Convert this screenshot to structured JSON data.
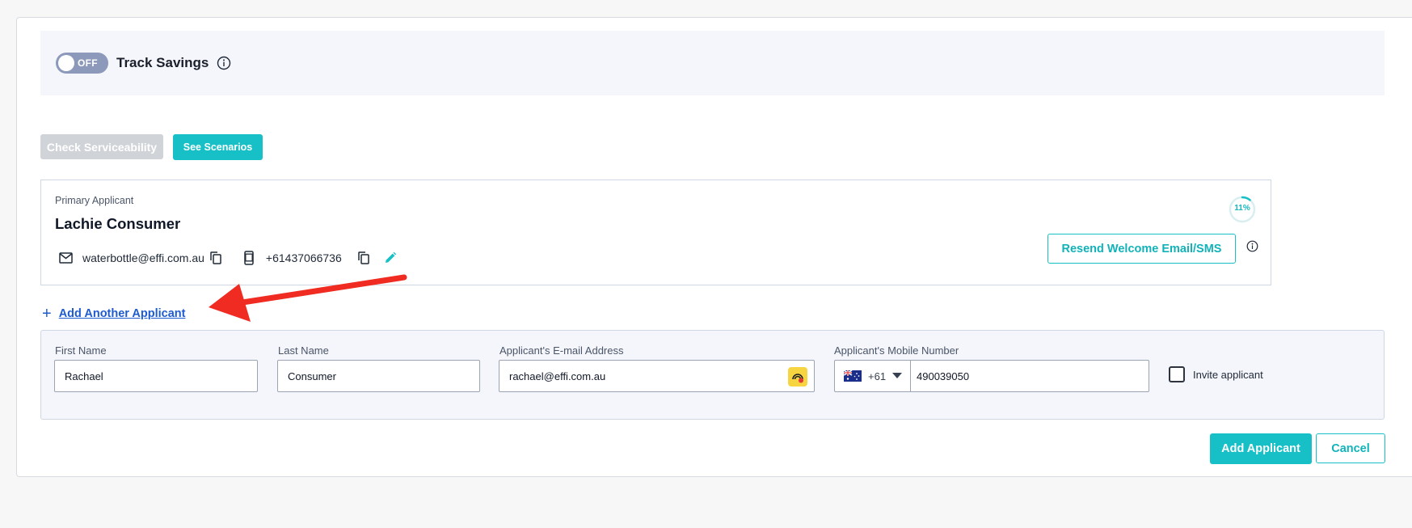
{
  "track_savings": {
    "toggle_state": "OFF",
    "label": "Track Savings"
  },
  "actions": {
    "check_serviceability": "Check Serviceability",
    "see_scenarios": "See Scenarios"
  },
  "primary_applicant": {
    "role": "Primary Applicant",
    "name": "Lachie Consumer",
    "email": "waterbottle@effi.com.au",
    "phone": "+61437066736",
    "progress_label": "11%",
    "progress_fraction": 0.11,
    "resend_label": "Resend Welcome Email/SMS"
  },
  "add_another": {
    "plus": "+",
    "label": "Add Another Applicant"
  },
  "form": {
    "first_name": {
      "label": "First Name",
      "value": "Rachael"
    },
    "last_name": {
      "label": "Last Name",
      "value": "Consumer"
    },
    "email": {
      "label": "Applicant's E-mail Address",
      "value": "rachael@effi.com.au"
    },
    "mobile": {
      "label": "Applicant's Mobile Number",
      "country_code": "+61",
      "value": "490039050"
    },
    "invite_label": "Invite applicant"
  },
  "buttons": {
    "add_applicant": "Add Applicant",
    "cancel": "Cancel"
  },
  "colors": {
    "accent": "#16c0c6",
    "link": "#1e5bd0",
    "annotation_arrow": "#ef2b22"
  }
}
